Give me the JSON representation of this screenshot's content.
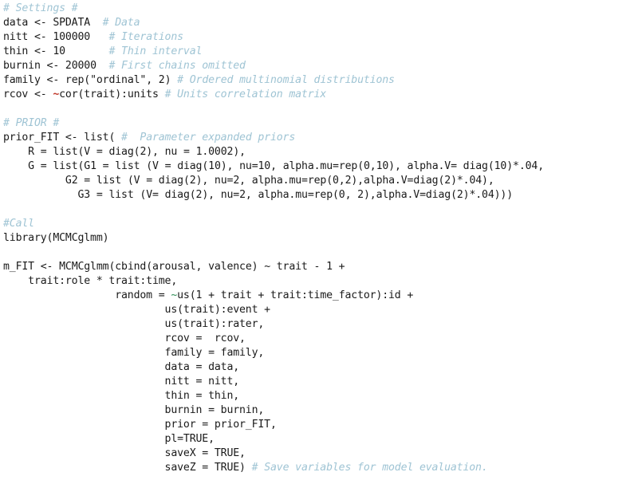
{
  "document": {
    "kind": "source-code-listing",
    "language": "R",
    "title": "MCMCglmm model specification",
    "font_family": "monospace",
    "background_color": "#ffffff"
  },
  "theme": {
    "plain": "#1a1a1a",
    "comment": "#9fc4d4",
    "function": "#19733c",
    "argument": "#c3776a",
    "number": "#5fa88b",
    "string": "#8a8a8a",
    "constant": "#3f8a5e",
    "tilde_red": "#c0392b",
    "tilde_green": "#2f8f57"
  },
  "lines": [
    {
      "n": 1,
      "text": "# Settings #",
      "tokens": [
        {
          "t": "# Settings #",
          "c": "comment"
        }
      ]
    },
    {
      "n": 2,
      "text": "data <- SPDATA  # Data",
      "tokens": [
        {
          "t": "data <- SPDATA  ",
          "c": "plain"
        },
        {
          "t": "# Data",
          "c": "comment"
        }
      ]
    },
    {
      "n": 3,
      "text": "nitt <- 100000   # Iterations",
      "tokens": [
        {
          "t": "nitt <- ",
          "c": "plain"
        },
        {
          "t": "100000",
          "c": "number"
        },
        {
          "t": "   ",
          "c": "plain"
        },
        {
          "t": "# Iterations",
          "c": "comment"
        }
      ]
    },
    {
      "n": 4,
      "text": "thin <- 10       # Thin interval",
      "tokens": [
        {
          "t": "thin <- ",
          "c": "plain"
        },
        {
          "t": "10",
          "c": "number"
        },
        {
          "t": "       ",
          "c": "plain"
        },
        {
          "t": "# Thin interval",
          "c": "comment"
        }
      ]
    },
    {
      "n": 5,
      "text": "burnin <- 20000  # First chains omitted",
      "tokens": [
        {
          "t": "burnin <- ",
          "c": "plain"
        },
        {
          "t": "20000",
          "c": "number"
        },
        {
          "t": "  ",
          "c": "plain"
        },
        {
          "t": "# First chains omitted",
          "c": "comment"
        }
      ]
    },
    {
      "n": 6,
      "text": "family <- rep(\"ordinal\", 2) # Ordered multinomial distributions",
      "tokens": [
        {
          "t": "family <- ",
          "c": "plain"
        },
        {
          "t": "rep",
          "c": "function"
        },
        {
          "t": "(",
          "c": "plain"
        },
        {
          "t": "\"ordinal\"",
          "c": "string"
        },
        {
          "t": ", ",
          "c": "plain"
        },
        {
          "t": "2",
          "c": "number"
        },
        {
          "t": ") ",
          "c": "plain"
        },
        {
          "t": "# Ordered multinomial distributions",
          "c": "comment"
        }
      ]
    },
    {
      "n": 7,
      "text": "rcov <- ~cor(trait):units # Units correlation matrix",
      "tokens": [
        {
          "t": "rcov <- ",
          "c": "plain"
        },
        {
          "t": "~",
          "c": "tilde_red"
        },
        {
          "t": "cor",
          "c": "function"
        },
        {
          "t": "(trait):units ",
          "c": "plain"
        },
        {
          "t": "# Units correlation matrix",
          "c": "comment"
        }
      ]
    },
    {
      "n": 8,
      "text": "",
      "tokens": []
    },
    {
      "n": 9,
      "text": "# PRIOR #",
      "tokens": [
        {
          "t": "# PRIOR #",
          "c": "comment"
        }
      ]
    },
    {
      "n": 10,
      "text": "prior_FIT <- list( #  Parameter expanded priors",
      "tokens": [
        {
          "t": "prior_FIT <- ",
          "c": "plain"
        },
        {
          "t": "list",
          "c": "function"
        },
        {
          "t": "( ",
          "c": "plain"
        },
        {
          "t": "#  Parameter expanded priors",
          "c": "comment"
        }
      ]
    },
    {
      "n": 11,
      "text": "    R = list(V = diag(2), nu = 1.0002),",
      "tokens": [
        {
          "t": "    ",
          "c": "plain"
        },
        {
          "t": "R",
          "c": "argument"
        },
        {
          "t": " = ",
          "c": "plain"
        },
        {
          "t": "list",
          "c": "function"
        },
        {
          "t": "(V = ",
          "c": "plain"
        },
        {
          "t": "diag",
          "c": "function"
        },
        {
          "t": "(",
          "c": "plain"
        },
        {
          "t": "2",
          "c": "number"
        },
        {
          "t": "), nu = ",
          "c": "plain"
        },
        {
          "t": "1.0002",
          "c": "number"
        },
        {
          "t": "),",
          "c": "plain"
        }
      ]
    },
    {
      "n": 12,
      "text": "    G = list(G1 = list (V = diag(10), nu=10, alpha.mu=rep(0,10), alpha.V= diag(10)*.04),",
      "tokens": [
        {
          "t": "    ",
          "c": "plain"
        },
        {
          "t": "G",
          "c": "argument"
        },
        {
          "t": " = ",
          "c": "plain"
        },
        {
          "t": "list",
          "c": "function"
        },
        {
          "t": "(G1 = ",
          "c": "plain"
        },
        {
          "t": "list",
          "c": "function"
        },
        {
          "t": " (V = ",
          "c": "plain"
        },
        {
          "t": "diag",
          "c": "function"
        },
        {
          "t": "(",
          "c": "plain"
        },
        {
          "t": "10",
          "c": "number"
        },
        {
          "t": "), nu=",
          "c": "plain"
        },
        {
          "t": "10",
          "c": "number"
        },
        {
          "t": ", ",
          "c": "plain"
        },
        {
          "t": "alpha.mu",
          "c": "argument"
        },
        {
          "t": "=",
          "c": "plain"
        },
        {
          "t": "rep",
          "c": "function"
        },
        {
          "t": "(",
          "c": "plain"
        },
        {
          "t": "0",
          "c": "number"
        },
        {
          "t": ",",
          "c": "plain"
        },
        {
          "t": "10",
          "c": "number"
        },
        {
          "t": "), ",
          "c": "plain"
        },
        {
          "t": "alpha.V",
          "c": "argument"
        },
        {
          "t": "= ",
          "c": "plain"
        },
        {
          "t": "diag",
          "c": "function"
        },
        {
          "t": "(",
          "c": "plain"
        },
        {
          "t": "10",
          "c": "number"
        },
        {
          "t": ")*",
          "c": "plain"
        },
        {
          "t": ".04",
          "c": "number"
        },
        {
          "t": ",",
          "c": "plain"
        }
      ]
    },
    {
      "n": 13,
      "text": "          G2 = list (V = diag(2), nu=2, alpha.mu=rep(0,2),alpha.V=diag(2)*.04),",
      "tokens": [
        {
          "t": "          ",
          "c": "plain"
        },
        {
          "t": "G2",
          "c": "argument"
        },
        {
          "t": " = ",
          "c": "plain"
        },
        {
          "t": "list",
          "c": "function"
        },
        {
          "t": " (V = ",
          "c": "plain"
        },
        {
          "t": "diag",
          "c": "function"
        },
        {
          "t": "(",
          "c": "plain"
        },
        {
          "t": "2",
          "c": "number"
        },
        {
          "t": "), nu=",
          "c": "plain"
        },
        {
          "t": "2",
          "c": "number"
        },
        {
          "t": ", ",
          "c": "plain"
        },
        {
          "t": "alpha.mu",
          "c": "argument"
        },
        {
          "t": "=",
          "c": "plain"
        },
        {
          "t": "rep",
          "c": "function"
        },
        {
          "t": "(",
          "c": "plain"
        },
        {
          "t": "0",
          "c": "number"
        },
        {
          "t": ",",
          "c": "plain"
        },
        {
          "t": "2",
          "c": "number"
        },
        {
          "t": "),",
          "c": "plain"
        },
        {
          "t": "alpha.V",
          "c": "argument"
        },
        {
          "t": "=",
          "c": "plain"
        },
        {
          "t": "diag",
          "c": "function"
        },
        {
          "t": "(",
          "c": "plain"
        },
        {
          "t": "2",
          "c": "number"
        },
        {
          "t": ")*",
          "c": "plain"
        },
        {
          "t": ".04",
          "c": "number"
        },
        {
          "t": "),",
          "c": "plain"
        }
      ]
    },
    {
      "n": 14,
      "text": "            G3 = list (V= diag(2), nu=2, alpha.mu=rep(0, 2),alpha.V=diag(2)*.04)))",
      "tokens": [
        {
          "t": "            ",
          "c": "plain"
        },
        {
          "t": "G3",
          "c": "argument"
        },
        {
          "t": " = ",
          "c": "plain"
        },
        {
          "t": "list",
          "c": "function"
        },
        {
          "t": " (V= ",
          "c": "plain"
        },
        {
          "t": "diag",
          "c": "function"
        },
        {
          "t": "(",
          "c": "plain"
        },
        {
          "t": "2",
          "c": "number"
        },
        {
          "t": "), nu=",
          "c": "plain"
        },
        {
          "t": "2",
          "c": "number"
        },
        {
          "t": ", ",
          "c": "plain"
        },
        {
          "t": "alpha.mu",
          "c": "argument"
        },
        {
          "t": "=",
          "c": "plain"
        },
        {
          "t": "rep",
          "c": "function"
        },
        {
          "t": "(",
          "c": "plain"
        },
        {
          "t": "0",
          "c": "number"
        },
        {
          "t": ", ",
          "c": "plain"
        },
        {
          "t": "2",
          "c": "number"
        },
        {
          "t": "),",
          "c": "plain"
        },
        {
          "t": "alpha.V",
          "c": "argument"
        },
        {
          "t": "=",
          "c": "plain"
        },
        {
          "t": "diag",
          "c": "function"
        },
        {
          "t": "(",
          "c": "plain"
        },
        {
          "t": "2",
          "c": "number"
        },
        {
          "t": ")*",
          "c": "plain"
        },
        {
          "t": ".04",
          "c": "number"
        },
        {
          "t": ")))",
          "c": "plain"
        }
      ]
    },
    {
      "n": 15,
      "text": "",
      "tokens": []
    },
    {
      "n": 16,
      "text": "#Call",
      "tokens": [
        {
          "t": "#Call",
          "c": "comment"
        }
      ]
    },
    {
      "n": 17,
      "text": "library(MCMCglmm)",
      "tokens": [
        {
          "t": "library",
          "c": "function"
        },
        {
          "t": "(MCMCglmm)",
          "c": "plain"
        }
      ]
    },
    {
      "n": 18,
      "text": "",
      "tokens": []
    },
    {
      "n": 19,
      "text": "m_FIT <- MCMCglmm(cbind(arousal, valence) ~ trait - 1 +",
      "tokens": [
        {
          "t": "m_FIT <- ",
          "c": "plain"
        },
        {
          "t": "MCMCglmm",
          "c": "function"
        },
        {
          "t": "(",
          "c": "plain"
        },
        {
          "t": "cbind",
          "c": "function"
        },
        {
          "t": "(arousal, valence) ~ trait - ",
          "c": "plain"
        },
        {
          "t": "1",
          "c": "number"
        },
        {
          "t": " +",
          "c": "plain"
        }
      ]
    },
    {
      "n": 20,
      "text": "    trait:role * trait:time,",
      "tokens": [
        {
          "t": "    trait:role * trait:time,",
          "c": "plain"
        }
      ]
    },
    {
      "n": 21,
      "text": "                  random = ~us(1 + trait + trait:time_factor):id +",
      "tokens": [
        {
          "t": "                  ",
          "c": "plain"
        },
        {
          "t": "random",
          "c": "argument"
        },
        {
          "t": " = ",
          "c": "plain"
        },
        {
          "t": "~",
          "c": "tilde_green"
        },
        {
          "t": "us",
          "c": "function"
        },
        {
          "t": "(",
          "c": "plain"
        },
        {
          "t": "1",
          "c": "number"
        },
        {
          "t": " + trait + trait:time_factor):id +",
          "c": "plain"
        }
      ]
    },
    {
      "n": 22,
      "text": "                          us(trait):event +",
      "tokens": [
        {
          "t": "                          ",
          "c": "plain"
        },
        {
          "t": "us",
          "c": "function"
        },
        {
          "t": "(trait):event +",
          "c": "plain"
        }
      ]
    },
    {
      "n": 23,
      "text": "                          us(trait):rater,",
      "tokens": [
        {
          "t": "                          ",
          "c": "plain"
        },
        {
          "t": "us",
          "c": "function"
        },
        {
          "t": "(trait):rater,",
          "c": "plain"
        }
      ]
    },
    {
      "n": 24,
      "text": "                          rcov =  rcov,",
      "tokens": [
        {
          "t": "                          ",
          "c": "plain"
        },
        {
          "t": "rcov",
          "c": "argument"
        },
        {
          "t": " =  rcov,",
          "c": "plain"
        }
      ]
    },
    {
      "n": 25,
      "text": "                          family = family,",
      "tokens": [
        {
          "t": "                          ",
          "c": "plain"
        },
        {
          "t": "family",
          "c": "argument"
        },
        {
          "t": " = family,",
          "c": "plain"
        }
      ]
    },
    {
      "n": 26,
      "text": "                          data = data,",
      "tokens": [
        {
          "t": "                          ",
          "c": "plain"
        },
        {
          "t": "data",
          "c": "argument"
        },
        {
          "t": " = data,",
          "c": "plain"
        }
      ]
    },
    {
      "n": 27,
      "text": "                          nitt = nitt,",
      "tokens": [
        {
          "t": "                          ",
          "c": "plain"
        },
        {
          "t": "nitt",
          "c": "argument"
        },
        {
          "t": " = nitt,",
          "c": "plain"
        }
      ]
    },
    {
      "n": 28,
      "text": "                          thin = thin,",
      "tokens": [
        {
          "t": "                          ",
          "c": "plain"
        },
        {
          "t": "thin",
          "c": "argument"
        },
        {
          "t": " = thin,",
          "c": "plain"
        }
      ]
    },
    {
      "n": 29,
      "text": "                          burnin = burnin,",
      "tokens": [
        {
          "t": "                          ",
          "c": "plain"
        },
        {
          "t": "burnin",
          "c": "argument"
        },
        {
          "t": " = burnin,",
          "c": "plain"
        }
      ]
    },
    {
      "n": 30,
      "text": "                          prior = prior_FIT,",
      "tokens": [
        {
          "t": "                          ",
          "c": "plain"
        },
        {
          "t": "prior",
          "c": "argument"
        },
        {
          "t": " = prior_FIT,",
          "c": "plain"
        }
      ]
    },
    {
      "n": 31,
      "text": "                          pl=TRUE,",
      "tokens": [
        {
          "t": "                          ",
          "c": "plain"
        },
        {
          "t": "pl",
          "c": "argument"
        },
        {
          "t": "=",
          "c": "plain"
        },
        {
          "t": "TRUE",
          "c": "constant"
        },
        {
          "t": ",",
          "c": "plain"
        }
      ]
    },
    {
      "n": 32,
      "text": "                          saveX = TRUE,",
      "tokens": [
        {
          "t": "                          ",
          "c": "plain"
        },
        {
          "t": "saveX",
          "c": "argument"
        },
        {
          "t": " = ",
          "c": "plain"
        },
        {
          "t": "TRUE",
          "c": "constant"
        },
        {
          "t": ",",
          "c": "plain"
        }
      ]
    },
    {
      "n": 33,
      "text": "                          saveZ = TRUE) # Save variables for model evaluation.",
      "tokens": [
        {
          "t": "                          ",
          "c": "plain"
        },
        {
          "t": "saveZ",
          "c": "argument"
        },
        {
          "t": " = ",
          "c": "plain"
        },
        {
          "t": "TRUE",
          "c": "constant"
        },
        {
          "t": ") ",
          "c": "plain"
        },
        {
          "t": "# Save variables for model evaluation.",
          "c": "comment"
        }
      ]
    }
  ]
}
